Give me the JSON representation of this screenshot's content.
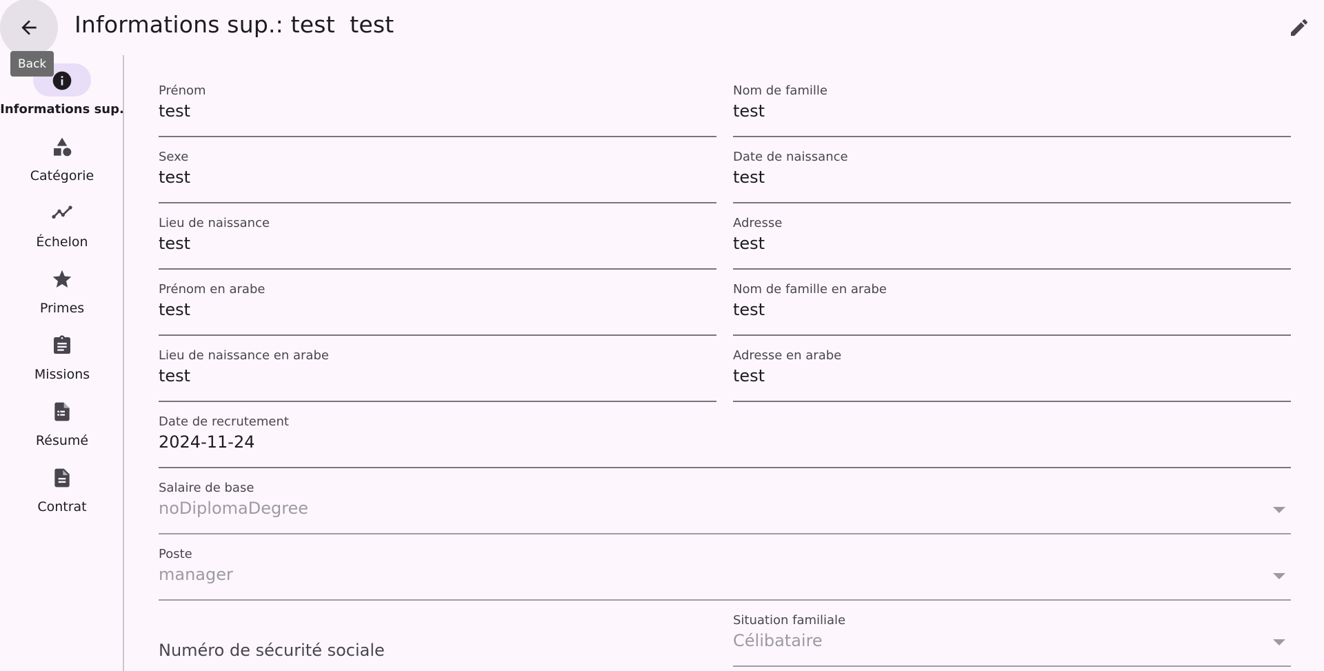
{
  "header": {
    "back_tooltip": "Back",
    "title": "Informations sup.: test  test"
  },
  "rail": {
    "items": [
      {
        "label": "Informations sup.",
        "icon": "info-icon",
        "selected": true
      },
      {
        "label": "Catégorie",
        "icon": "category-shapes-icon"
      },
      {
        "label": "Échelon",
        "icon": "trend-line-icon"
      },
      {
        "label": "Primes",
        "icon": "star-icon"
      },
      {
        "label": "Missions",
        "icon": "clipboard-icon"
      },
      {
        "label": "Résumé",
        "icon": "summary-document-icon"
      },
      {
        "label": "Contrat",
        "icon": "document-icon"
      }
    ]
  },
  "form": {
    "prenom": {
      "label": "Prénom",
      "value": "test"
    },
    "nom_famille": {
      "label": "Nom de famille",
      "value": "test"
    },
    "sexe": {
      "label": "Sexe",
      "value": "test"
    },
    "date_naissance": {
      "label": "Date de naissance",
      "value": "test"
    },
    "lieu_naissance": {
      "label": "Lieu de naissance",
      "value": "test"
    },
    "adresse": {
      "label": "Adresse",
      "value": "test"
    },
    "prenom_arabe": {
      "label": "Prénom en arabe",
      "value": "test"
    },
    "nom_famille_arabe": {
      "label": "Nom de famille en arabe",
      "value": "test"
    },
    "lieu_naissance_arabe": {
      "label": "Lieu de naissance en arabe",
      "value": "test"
    },
    "adresse_arabe": {
      "label": "Adresse en arabe",
      "value": "test"
    },
    "date_recrutement": {
      "label": "Date de recrutement",
      "value": "2024-11-24"
    },
    "salaire_base": {
      "label": "Salaire de base",
      "value": "noDiplomaDegree"
    },
    "poste": {
      "label": "Poste",
      "value": "manager"
    },
    "securite_sociale": {
      "label": "Numéro de sécurité sociale",
      "value": ""
    },
    "situation_familiale": {
      "label": "Situation familiale",
      "value": "Célibataire"
    }
  },
  "colors": {
    "background": "#fdf7fd",
    "rail_indicator": "#e8def8",
    "divider": "#cac4d0",
    "text": "#1d1b20"
  }
}
